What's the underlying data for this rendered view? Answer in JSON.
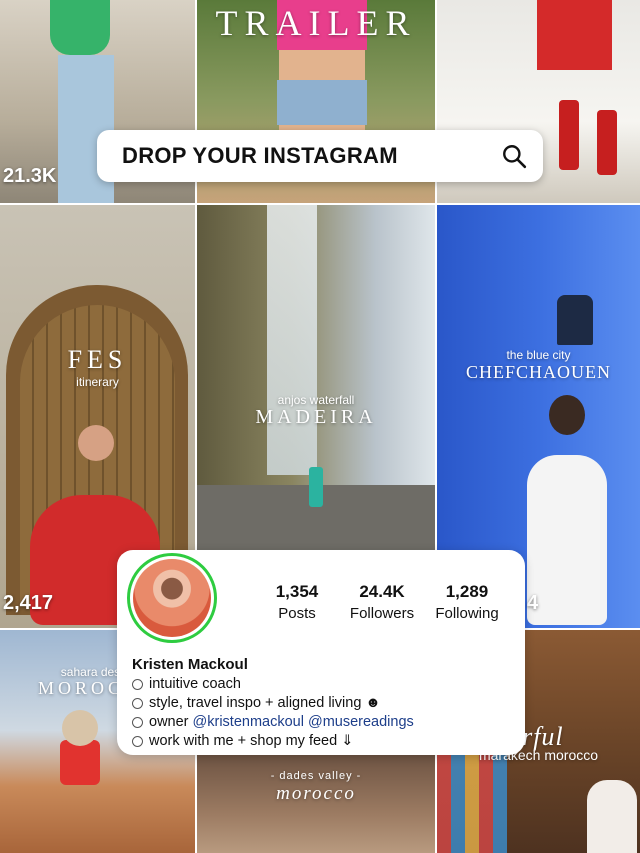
{
  "search": {
    "placeholder": "DROP YOUR INSTAGRAM",
    "icon": "search-icon"
  },
  "grid": {
    "tiles": [
      {
        "caption": "",
        "count": "21.3K"
      },
      {
        "caption": "TRAILER",
        "count": ""
      },
      {
        "caption": "",
        "count": ""
      },
      {
        "caption_small": "itinerary",
        "caption": "FES",
        "count": "2,417"
      },
      {
        "caption_small": "anjos waterfall",
        "caption": "MADEIRA",
        "count": ""
      },
      {
        "caption_small": "the blue city",
        "caption": "CHEFCHAOUEN",
        "count": "4"
      },
      {
        "caption_small": "sahara desert",
        "caption": "MOROCCO",
        "count": ""
      },
      {
        "caption_small": "- dades valley -",
        "caption": "morocco",
        "count": ""
      },
      {
        "caption_small": "marakech morocco",
        "caption": "colorful",
        "count": ""
      }
    ]
  },
  "profile": {
    "stats": [
      {
        "value": "1,354",
        "label": "Posts"
      },
      {
        "value": "24.4K",
        "label": "Followers"
      },
      {
        "value": "1,289",
        "label": "Following"
      }
    ],
    "name": "Kristen Mackoul",
    "bio": [
      "intuitive coach",
      "style, travel inspo + aligned living ☻",
      "owner",
      "work with me + shop my feed ⇓"
    ],
    "links": "@kristenmackoul @musereadings"
  },
  "colors": {
    "story_ring": "#2ecc40",
    "link": "#1d3e8a"
  }
}
